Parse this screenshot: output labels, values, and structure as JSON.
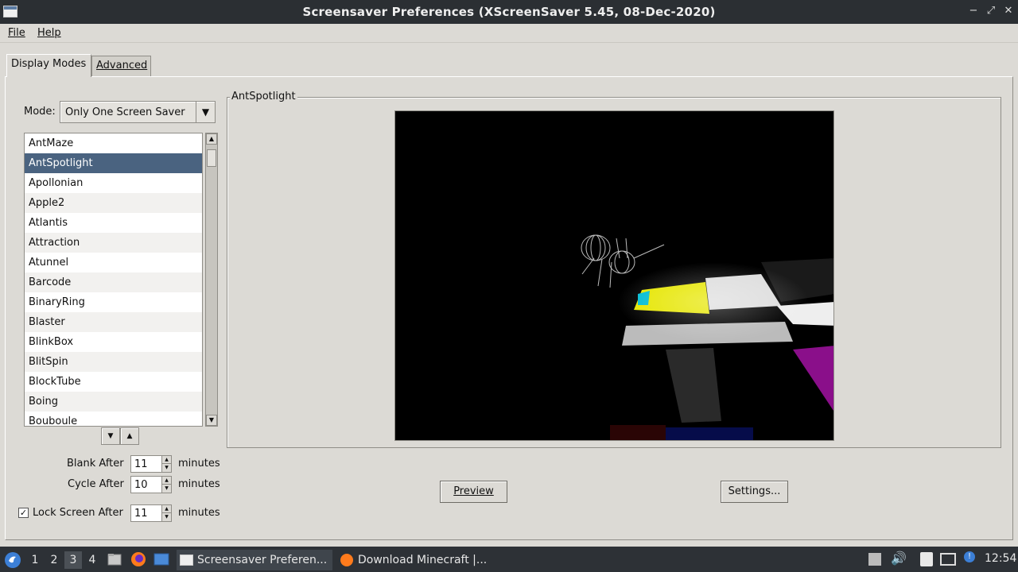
{
  "window": {
    "title": "Screensaver Preferences  (XScreenSaver 5.45, 08-Dec-2020)",
    "controls": [
      "−",
      "⤢",
      "✕"
    ]
  },
  "menu": {
    "file": "File",
    "help": "Help"
  },
  "tabs": {
    "display_modes": "Display Modes",
    "advanced": "Advanced"
  },
  "mode": {
    "label": "Mode:",
    "value": "Only One Screen Saver"
  },
  "savers": [
    "AntMaze",
    "AntSpotlight",
    "Apollonian",
    "Apple2",
    "Atlantis",
    "Attraction",
    "Atunnel",
    "Barcode",
    "BinaryRing",
    "Blaster",
    "BlinkBox",
    "BlitSpin",
    "BlockTube",
    "Boing",
    "Bouboule"
  ],
  "selected_index": 1,
  "timing": {
    "blank_after_label": "Blank After",
    "blank_after_value": "11",
    "cycle_after_label": "Cycle After",
    "cycle_after_value": "10",
    "lock_label": "Lock Screen After",
    "lock_value": "11",
    "lock_checked": true,
    "unit": "minutes"
  },
  "preview_frame": {
    "title": "AntSpotlight"
  },
  "buttons": {
    "preview": "Preview",
    "settings": "Settings..."
  },
  "taskbar": {
    "workspaces": [
      "1",
      "2",
      "3",
      "4"
    ],
    "current_workspace": "3",
    "tasks": [
      "Screensaver Preferen...",
      "Download Minecraft |..."
    ],
    "clock": "12:54"
  },
  "colors": {
    "selection": "#4a6380",
    "titlebar": "#2b2f33",
    "taskbar": "#2d3136"
  }
}
